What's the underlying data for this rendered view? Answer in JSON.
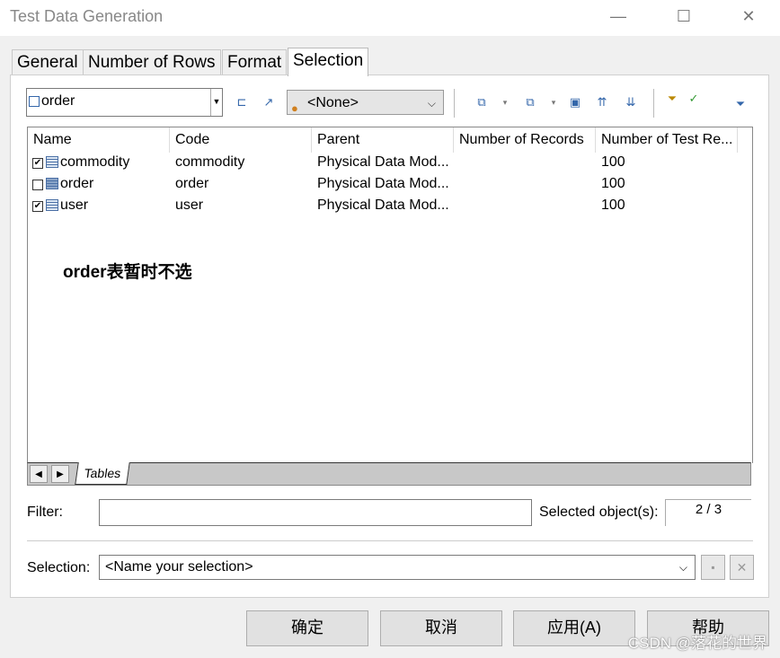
{
  "window": {
    "title": "Test Data Generation",
    "minimize": "—",
    "maximize": "☐",
    "close": "✕"
  },
  "tabs": [
    {
      "label": "General"
    },
    {
      "label": "Number of Rows"
    },
    {
      "label": "Format"
    },
    {
      "label": "Selection"
    }
  ],
  "toolbar": {
    "object_combo": "order",
    "owner_combo": "<None>"
  },
  "grid": {
    "columns": [
      "Name",
      "Code",
      "Parent",
      "Number of Records",
      "Number of Test Re..."
    ],
    "rows": [
      {
        "checked": true,
        "name": "commodity",
        "code": "commodity",
        "parent": "Physical Data Mod...",
        "records": "",
        "test_records": "100"
      },
      {
        "checked": false,
        "name": "order",
        "code": "order",
        "parent": "Physical Data Mod...",
        "records": "",
        "test_records": "100"
      },
      {
        "checked": true,
        "name": "user",
        "code": "user",
        "parent": "Physical Data Mod...",
        "records": "",
        "test_records": "100"
      }
    ],
    "annotation": "order表暂时不选",
    "sheet_tab": "Tables"
  },
  "filter": {
    "label": "Filter:",
    "value": ""
  },
  "selected_objects": {
    "label": "Selected object(s):",
    "value": "2 / 3"
  },
  "selection": {
    "label": "Selection:",
    "value": "<Name your selection>"
  },
  "buttons": {
    "ok": "确定",
    "cancel": "取消",
    "apply": "应用(A)",
    "help": "帮助"
  },
  "watermark": "CSDN @落花的世界"
}
